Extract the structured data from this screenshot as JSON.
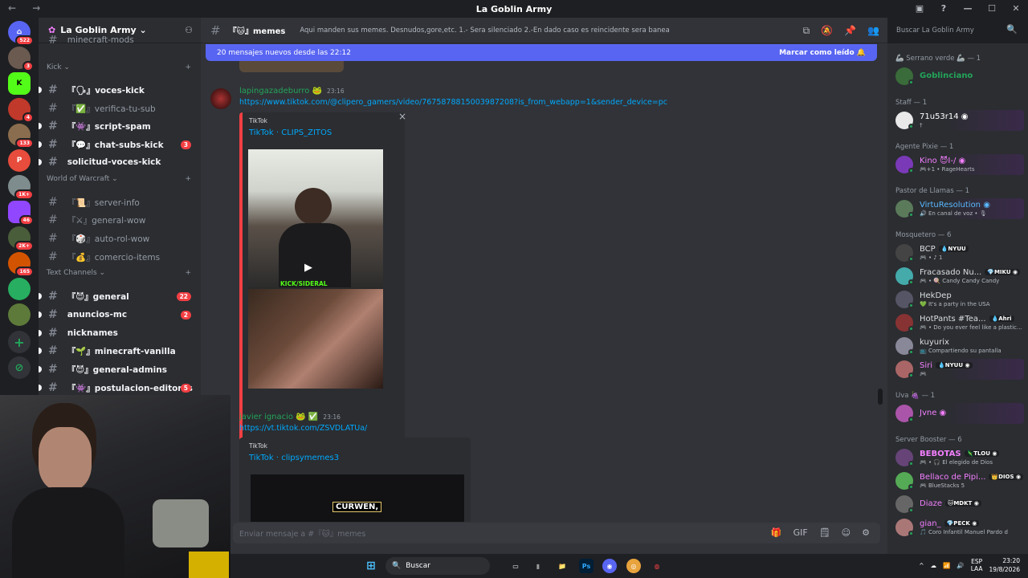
{
  "window": {
    "title": "La Goblin Army",
    "nav": "← →",
    "controls": [
      "▣",
      "?",
      "—",
      "☐",
      "✕"
    ]
  },
  "servers": {
    "badges": [
      "522",
      "3",
      "",
      "4",
      "133",
      "",
      "1K+",
      "46",
      "2K+",
      "165",
      "",
      ""
    ],
    "labels": [
      "⌂",
      "",
      "K",
      "",
      "",
      "P",
      "",
      "",
      "",
      "",
      "",
      ""
    ],
    "add": "+",
    "explore": "⊘"
  },
  "guild": {
    "name": "La Goblin Army ⌄",
    "add_icon": "⚇"
  },
  "sidebar": {
    "partial_top": "minecraft-mods",
    "categories": {
      "kick": "Kick ⌄",
      "wow": "World of Warcraft ⌄",
      "text": "Text Channels ⌄"
    },
    "channels": [
      {
        "name": "『🗣』voces-kick",
        "badge": "",
        "unread": true
      },
      {
        "name": "『✅』verifica-tu-sub",
        "badge": "",
        "unread": false
      },
      {
        "name": "『👾』script-spam",
        "badge": "",
        "unread": true
      },
      {
        "name": "『💬』chat-subs-kick",
        "badge": "3",
        "unread": true
      },
      {
        "name": "solicitud-voces-kick",
        "badge": "",
        "unread": true
      },
      {
        "name": "『📜』server-info",
        "badge": "",
        "unread": false
      },
      {
        "name": "『⚔』general-wow",
        "badge": "",
        "unread": false
      },
      {
        "name": "『🎲』auto-rol-wow",
        "badge": "",
        "unread": false
      },
      {
        "name": "『💰』comercio-items",
        "badge": "",
        "unread": false
      },
      {
        "name": "『😈』general",
        "badge": "22",
        "unread": true
      },
      {
        "name": "anuncios-mc",
        "badge": "2",
        "unread": true
      },
      {
        "name": "nicknames",
        "badge": "",
        "unread": true
      },
      {
        "name": "『🌱』minecraft-vanilla",
        "badge": "",
        "unread": true
      },
      {
        "name": "『😈』general-admins",
        "badge": "",
        "unread": true
      },
      {
        "name": "『👾』postulacion-editores",
        "badge": "5",
        "unread": true
      }
    ]
  },
  "header": {
    "channel": "『🐱』memes",
    "topic": "Aqui manden sus memes. Desnudos,gore,etc. 1.- Sera silenciado 2.-En dado caso es reincidente sera baneado",
    "icons": [
      "⧉",
      "🔕",
      "📌",
      "👥"
    ],
    "search_placeholder": "Buscar La Goblin Army",
    "search_icon": "🔍"
  },
  "new_messages": {
    "text": "20 mensajes nuevos desde las 22:12",
    "action": "Marcar como leído 🔔"
  },
  "messages": [
    {
      "author": "lapingazadeburro 🐸",
      "time": "23:16",
      "link": "https://www.tiktok.com/@clipero_gamers/video/7675878815003987208?is_from_webapp=1&sender_device=pc",
      "embed_provider": "TikTok",
      "embed_title": "TikTok · CLIPS_ZITOS",
      "video_caption": "KICK/SIDERAL",
      "close": "×"
    },
    {
      "author": "javier ignacio 🐸 ✅",
      "time": "23:16",
      "link": "https://vt.tiktok.com/ZSVDLATUa/",
      "embed_provider": "TikTok",
      "embed_title": "TikTok · clipsymemes3",
      "video_caption": "CURWEN,"
    }
  ],
  "composer": {
    "placeholder": "Enviar mensaje a #『🐱』memes",
    "tools": [
      "🎁",
      "GIF",
      "🗒",
      "☺",
      "⚙"
    ]
  },
  "members": {
    "groups": [
      {
        "role": "🦾 Serrano verde 🦾 — 1",
        "items": [
          {
            "name": "Goblinciano",
            "sub": "",
            "tag": "",
            "color": "#23a55a",
            "bold": true
          }
        ]
      },
      {
        "role": "Staff — 1",
        "items": [
          {
            "name": "71u53r14 ◉",
            "sub": "†",
            "tag": "",
            "color": "#ffffff",
            "bold": false
          }
        ]
      },
      {
        "role": "Agente Pixie — 1",
        "items": [
          {
            "name": "Kino 😈I-/ ◉",
            "sub": "🎮+1 • RageHearts",
            "tag": "",
            "color": "#f47fff",
            "bold": false
          }
        ]
      },
      {
        "role": "Pastor de Llamas — 1",
        "items": [
          {
            "name": "VirtuResolution ◉",
            "sub": "🔊 En canal de voz • 🎙",
            "tag": "",
            "color": "#5ab9ff",
            "bold": false
          }
        ]
      },
      {
        "role": "Mosquetero — 6",
        "items": [
          {
            "name": "BCP",
            "sub": "🎮 • ♪ 1",
            "tag": "💧NYUU",
            "color": "#dbdee1",
            "bold": false
          },
          {
            "name": "Fracasado Nu...",
            "sub": "🎮 • 🍭 Candy Candy Candy",
            "tag": "💎MIKU ◉",
            "color": "#dbdee1",
            "bold": false
          },
          {
            "name": "HekDep",
            "sub": "💚 It's a party in the USA",
            "tag": "",
            "color": "#dbdee1",
            "bold": false
          },
          {
            "name": "HotPants #Tea...",
            "sub": "🎮 • Do you ever feel like a plastic...",
            "tag": "💧Ahri",
            "color": "#dbdee1",
            "bold": false
          },
          {
            "name": "kuyurix",
            "sub": "📺 Compartiendo su pantalla",
            "tag": "",
            "color": "#dbdee1",
            "bold": false
          },
          {
            "name": "Siri",
            "sub": "🎮",
            "tag": "💧NYUU ◉",
            "color": "#f47fff",
            "bold": false
          }
        ]
      },
      {
        "role": "Uva 🍇 — 1",
        "items": [
          {
            "name": "Jvne ◉",
            "sub": "",
            "tag": "",
            "color": "#f47fff",
            "bold": false
          }
        ]
      },
      {
        "role": "Server Booster — 6",
        "items": [
          {
            "name": "BEBOTAS",
            "sub": "🎮 • 🎧 El elegido de Dios",
            "tag": "🦎TLOU ◉",
            "color": "#f47fff",
            "bold": true
          },
          {
            "name": "Bellaco de Pipi...",
            "sub": "🎮 BlueStacks 5",
            "tag": "👑DIOS ◉",
            "color": "#f47fff",
            "bold": false
          },
          {
            "name": "Diaze",
            "sub": "",
            "tag": "🐱MDKT ◉",
            "color": "#f47fff",
            "bold": false
          },
          {
            "name": "gian_",
            "sub": "🎵 Coro Infantil Manuel Pardo d",
            "tag": "💎PECK ◉",
            "color": "#f47fff",
            "bold": false
          }
        ]
      }
    ]
  },
  "taskbar": {
    "search": "Buscar",
    "search_icon": "🔍",
    "apps": [
      "⊞",
      "▭",
      "▮",
      "📁",
      "Ps",
      "◉",
      "◎",
      "◍"
    ],
    "tray_icons": [
      "^",
      "☁",
      "📶",
      "🔊"
    ],
    "lang": "ESP\nLAA",
    "time": "23:20",
    "date": "19/8/2026"
  },
  "colors": {
    "blurple": "#5865f2",
    "green": "#23a55a",
    "red": "#f23f43",
    "link": "#00a8fc"
  }
}
